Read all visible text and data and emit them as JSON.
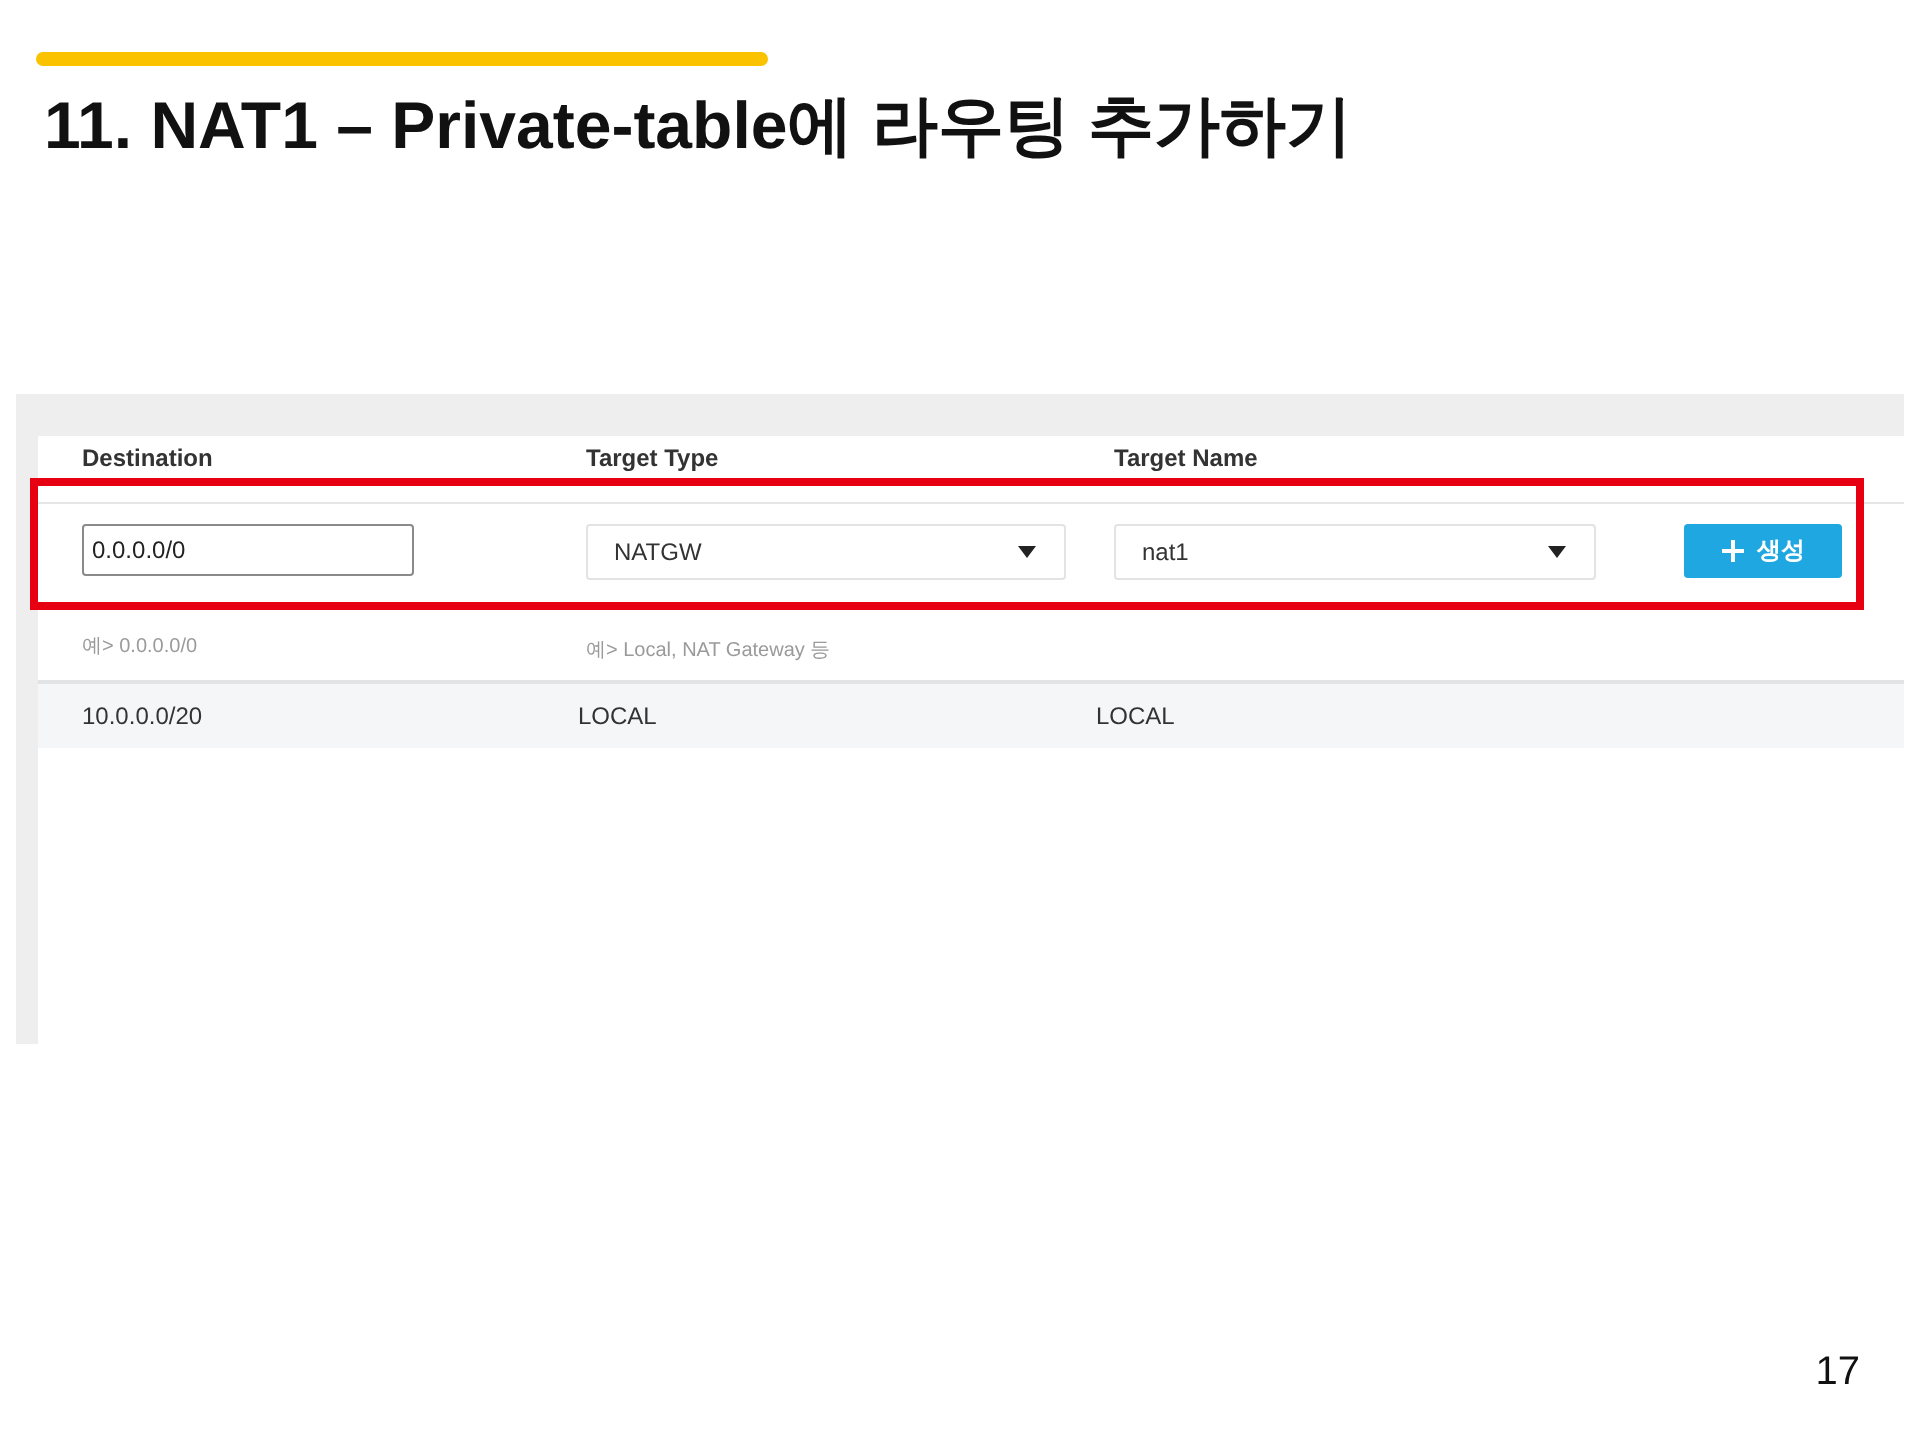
{
  "slide": {
    "title": "11. NAT1 – Private-table에 라우팅 추가하기",
    "page_number": "17"
  },
  "route_form": {
    "columns": [
      "Destination",
      "Target Type",
      "Target Name"
    ],
    "destination": {
      "value": "0.0.0.0/0",
      "hint": "예> 0.0.0.0/0"
    },
    "target_type": {
      "value": "NATGW",
      "hint": "예> Local, NAT Gateway 등"
    },
    "target_name": {
      "value": "nat1"
    },
    "create_button": {
      "label": "생성"
    }
  },
  "routes": [
    {
      "destination": "10.0.0.0/20",
      "target_type": "LOCAL",
      "target_name": "LOCAL"
    }
  ]
}
